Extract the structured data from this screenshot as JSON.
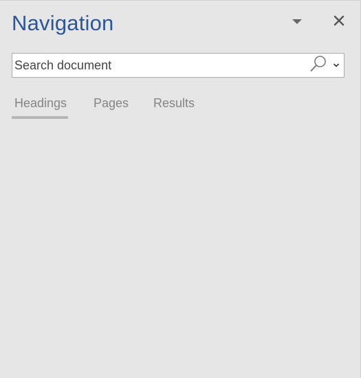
{
  "pane": {
    "title": "Navigation",
    "options_icon": "caret-down-icon",
    "close_icon": "close-icon"
  },
  "search": {
    "placeholder": "Search document",
    "value": "",
    "search_icon": "magnifier-icon",
    "dropdown_icon": "chevron-down-icon"
  },
  "tabs": [
    {
      "label": "Headings",
      "selected": true
    },
    {
      "label": "Pages",
      "selected": false
    },
    {
      "label": "Results",
      "selected": false
    }
  ],
  "colors": {
    "title": "#2b579a",
    "background": "#e6e6e6",
    "tab_text": "#848484",
    "tab_underline": "#b6b6b6"
  }
}
